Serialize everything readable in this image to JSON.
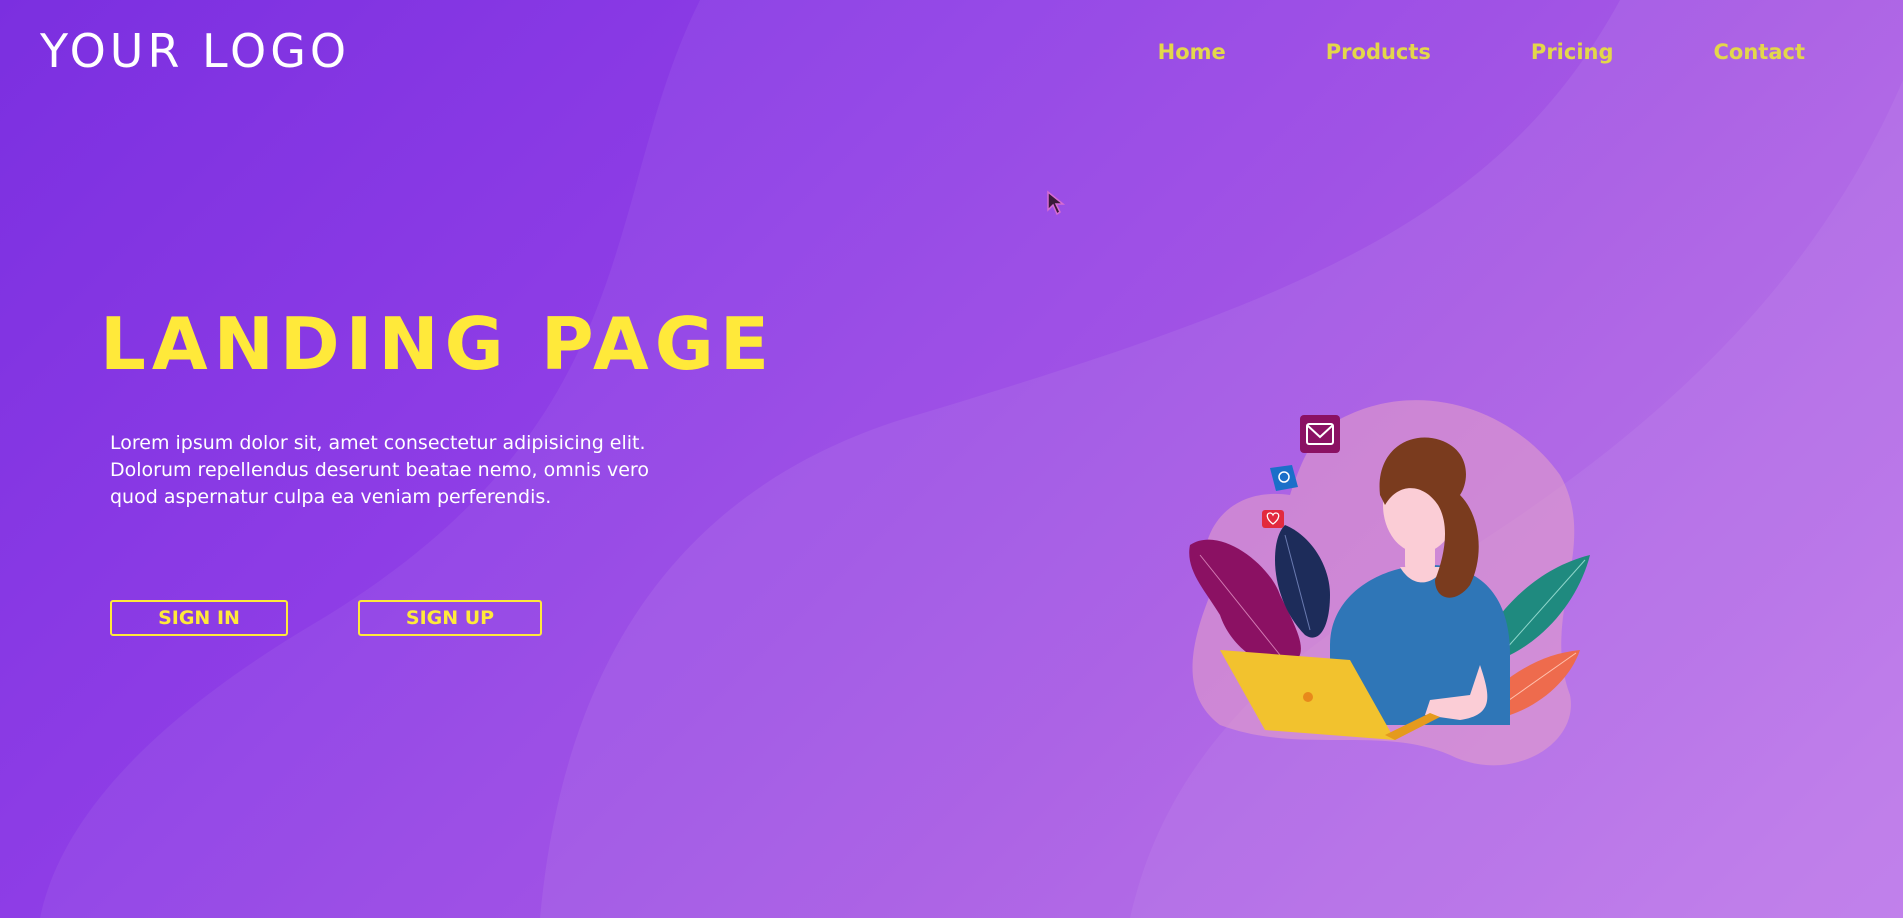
{
  "header": {
    "logo_text": "YOUR LOGO",
    "nav": [
      "Home",
      "Products",
      "Pricing",
      "Contact"
    ]
  },
  "hero": {
    "title": "LANDING PAGE",
    "body": "Lorem ipsum dolor sit, amet consectetur adipisicing elit. Dolorum repellendus deserunt beatae nemo, omnis vero quod aspernatur culpa ea veniam perferendis.",
    "signin_label": "SIGN IN",
    "signup_label": "SIGN UP"
  },
  "illustration": {
    "icons": [
      "mail-icon",
      "location-pin-icon",
      "heart-icon",
      "laptop-icon"
    ]
  },
  "colors": {
    "accent_yellow": "#ffe93a",
    "nav_text": "#e3d74a",
    "background": "#8f3ee6"
  }
}
